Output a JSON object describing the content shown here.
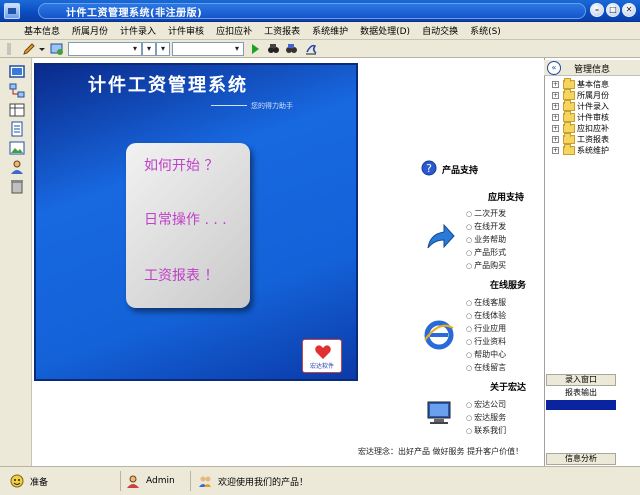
{
  "window": {
    "title": "计件工资管理系统(非注册版)"
  },
  "menu": [
    "基本信息",
    "所属月份",
    "计件录入",
    "计件审核",
    "应扣应补",
    "工资报表",
    "系统维护",
    "数据处理(D)",
    "自动交换",
    "系统(S)"
  ],
  "banner": {
    "title": "计件工资管理系统",
    "subtitle": "您的得力助手",
    "links": [
      "如何开始 ？",
      "日常操作 . . .",
      "工资报表 ！"
    ],
    "badge_text": "宏达软件"
  },
  "support": {
    "product_support": "产品支持",
    "app_support": {
      "title": "应用支持",
      "items": [
        "二次开发",
        "在线开发",
        "业务帮助",
        "产品形式",
        "产品购买"
      ]
    },
    "online_service": {
      "title": "在线服务",
      "items": [
        "在线客服",
        "在线体验",
        "行业应用",
        "行业资料",
        "帮助中心",
        "在线留言"
      ]
    },
    "about": {
      "title": "关于宏达",
      "items": [
        "宏达公司",
        "宏达服务",
        "联系我们"
      ]
    },
    "slogan": "宏达理念：出好产品  做好服务  提升客户价值！"
  },
  "management": {
    "title": "管理信息",
    "tree": [
      "基本信息",
      "所属月份",
      "计件录入",
      "计件审核",
      "应扣应补",
      "工资报表",
      "系统维护"
    ],
    "entry_tab": "录入窗口",
    "report_tab": "报表输出",
    "analysis_tab": "信息分析"
  },
  "status": {
    "ready": "准备",
    "user": "Admin",
    "welcome": "欢迎使用我们的产品！"
  },
  "colors": {
    "titlebar": "#0b4cc0",
    "banner": "#1462d8",
    "link_pink": "#c040c8",
    "selected": "#0a24a0"
  }
}
